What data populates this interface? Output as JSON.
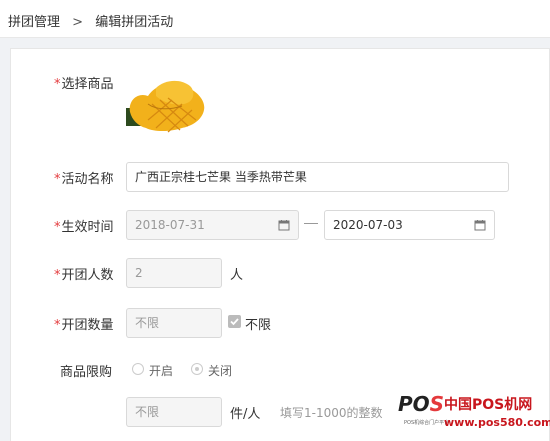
{
  "breadcrumb": {
    "parent": "拼团管理",
    "separator": ">",
    "current": "编辑拼团活动"
  },
  "form": {
    "product": {
      "label": "选择商品",
      "required_mark": "*"
    },
    "activity_name": {
      "label": "活动名称",
      "required_mark": "*",
      "value": "广西正宗桂七芒果 当季热带芒果"
    },
    "valid_time": {
      "label": "生效时间",
      "required_mark": "*",
      "start": "2018-07-31",
      "end": "2020-07-03"
    },
    "group_size": {
      "label": "开团人数",
      "required_mark": "*",
      "value": "2",
      "unit": "人"
    },
    "group_count": {
      "label": "开团数量",
      "required_mark": "*",
      "value": "不限",
      "checkbox_label": "不限",
      "checked": true
    },
    "purchase_limit": {
      "label": "商品限购",
      "options": [
        "开启",
        "关闭"
      ],
      "selected": "关闭",
      "value": "不限",
      "unit": "件/人",
      "hint": "填写1-1000的整数"
    }
  },
  "watermark": {
    "logo_left": "PO",
    "logo_right": "S",
    "title": "中国POS机网",
    "subtitle": "POS机综合门户平台",
    "url": "www.pos580.com"
  },
  "colors": {
    "required": "#e4393c",
    "disabled_bg": "#f5f5f5",
    "watermark_red": "#c8161d"
  }
}
